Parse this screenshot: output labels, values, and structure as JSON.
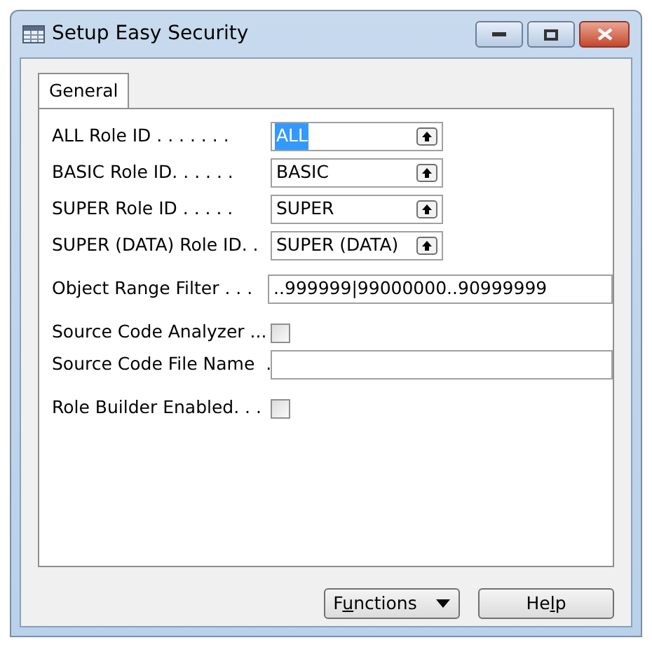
{
  "window": {
    "title": "Setup Easy Security"
  },
  "tabs": [
    {
      "label": "General",
      "selected": true
    }
  ],
  "fields": [
    {
      "kind": "lookup",
      "label": "ALL Role ID . . . . . . .",
      "value": "ALL",
      "value_selected": true
    },
    {
      "kind": "lookup",
      "label": "BASIC Role ID. . . . . .",
      "value": "BASIC",
      "value_selected": false
    },
    {
      "kind": "lookup",
      "label": "SUPER Role ID . . . . .",
      "value": "SUPER",
      "value_selected": false
    },
    {
      "kind": "lookup",
      "label": "SUPER (DATA) Role ID. .",
      "value": "SUPER (DATA)",
      "value_selected": false
    },
    {
      "kind": "text",
      "label": "Object Range Filter . . .",
      "value": "..999999|99000000..90999999"
    },
    {
      "kind": "checkbox",
      "label": "Source Code Analyzer ...",
      "checked": false
    },
    {
      "kind": "text",
      "label": "Source Code File Name  ."
    },
    {
      "kind": "checkbox",
      "label": "Role Builder Enabled. . .",
      "checked": false
    }
  ],
  "buttons": [
    {
      "label_before": "F",
      "mnemonic": "u",
      "label_after": "nctions",
      "has_menu": true
    },
    {
      "label_before": "He",
      "mnemonic": "l",
      "label_after": "p",
      "has_menu": false
    }
  ]
}
